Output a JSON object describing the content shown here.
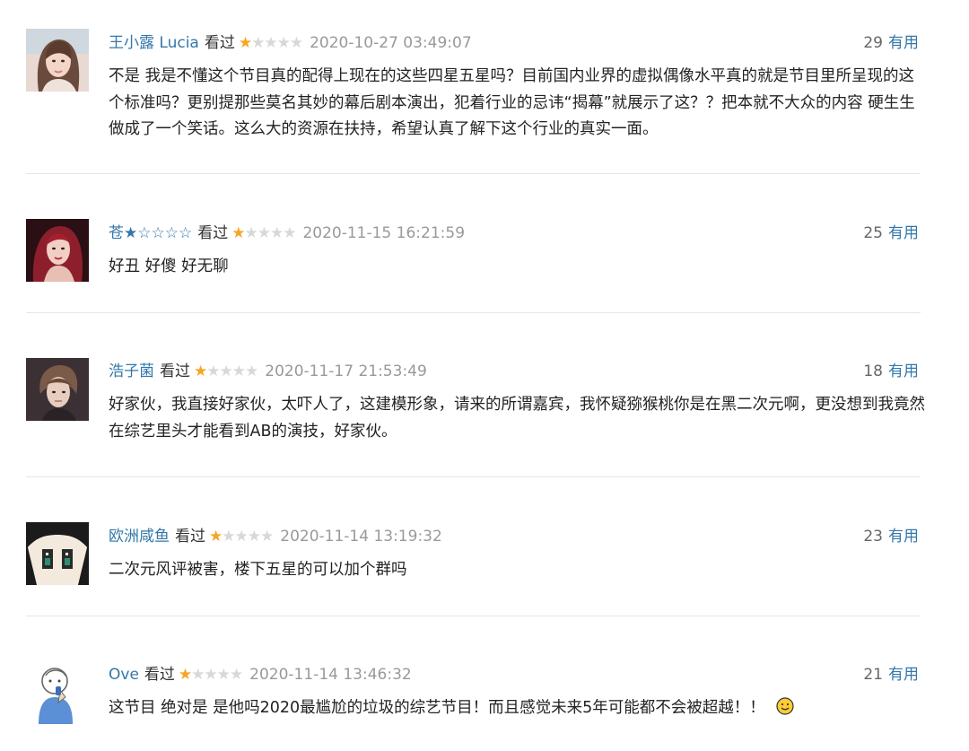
{
  "colors": {
    "username": "#3377aa",
    "useful_link": "#3377aa",
    "star_on": "#f5a623",
    "star_off": "#d8d8d8",
    "time": "#999999",
    "body_text": "#222222",
    "divider": "#e6e6e6"
  },
  "comments": [
    {
      "user": "王小露 Lucia",
      "status": "看过",
      "rating": 1,
      "rating_max": 5,
      "time": "2020-10-27 03:49:07",
      "votes": "29",
      "vote_label": "有用",
      "avatar_icon": "avatar-woman-icon",
      "text": "不是 我是不懂这个节目真的配得上现在的这些四星五星吗？目前国内业界的虚拟偶像水平真的就是节目里所呈现的这个标准吗？更别提那些莫名其妙的幕后剧本演出，犯着行业的忌讳“揭幕”就展示了这？？把本就不大众的内容 硬生生做成了一个笑话。这么大的资源在扶持，希望认真了解下这个行业的真实一面。"
    },
    {
      "user": "苍★☆☆☆☆",
      "status": "看过",
      "rating": 1,
      "rating_max": 5,
      "time": "2020-11-15 16:21:59",
      "votes": "25",
      "vote_label": "有用",
      "avatar_icon": "avatar-redhair-icon",
      "text": "好丑 好傻 好无聊"
    },
    {
      "user": "浩子菌",
      "status": "看过",
      "rating": 1,
      "rating_max": 5,
      "time": "2020-11-17 21:53:49",
      "votes": "18",
      "vote_label": "有用",
      "avatar_icon": "avatar-boy-icon",
      "text": "好家伙，我直接好家伙，太吓人了，这建模形象，请来的所谓嘉宾，我怀疑猕猴桃你是在黑二次元啊，更没想到我竟然在综艺里头才能看到AB的演技，好家伙。"
    },
    {
      "user": "欧洲咸鱼",
      "status": "看过",
      "rating": 1,
      "rating_max": 5,
      "time": "2020-11-14 13:19:32",
      "votes": "23",
      "vote_label": "有用",
      "avatar_icon": "avatar-anime-icon",
      "text": "二次元风评被害，楼下五星的可以加个群吗"
    },
    {
      "user": "Ove",
      "status": "看过",
      "rating": 1,
      "rating_max": 5,
      "time": "2020-11-14 13:46:32",
      "votes": "21",
      "vote_label": "有用",
      "avatar_icon": "avatar-sketch-icon",
      "text": "这节目 绝对是 是他吗2020最尴尬的垃圾的综艺节目！而且感觉未来5年可能都不会被超越！！",
      "emoji_icon": "smiley-emoji-icon"
    }
  ]
}
